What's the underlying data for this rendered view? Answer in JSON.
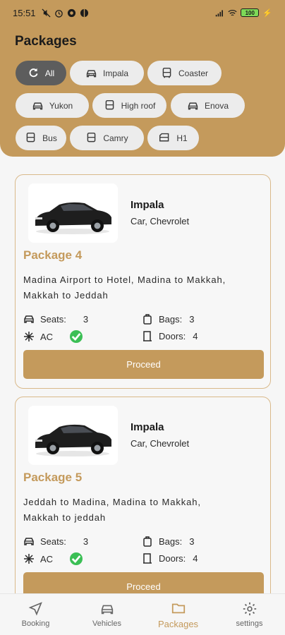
{
  "status": {
    "time": "15:51",
    "battery": "100"
  },
  "header": {
    "title": "Packages"
  },
  "filters": [
    {
      "label": "All",
      "icon": "refresh-icon",
      "active": true
    },
    {
      "label": "Impala",
      "icon": "car-icon"
    },
    {
      "label": "Coaster",
      "icon": "bus-icon"
    },
    {
      "label": "Yukon",
      "icon": "car-icon"
    },
    {
      "label": "High roof",
      "icon": "bus-icon"
    },
    {
      "label": "Enova",
      "icon": "car-icon"
    },
    {
      "label": "Bus",
      "icon": "bus-icon"
    },
    {
      "label": "Camry",
      "icon": "bus-icon"
    },
    {
      "label": "H1",
      "icon": "van-icon"
    }
  ],
  "packages": [
    {
      "model": "Impala",
      "brand": "Car, Chevrolet",
      "title": "Package 4",
      "route": "Madina Airport to Hotel, Madina to Makkah, Makkah to Jeddah",
      "seats_label": "Seats:",
      "seats": "3",
      "bags_label": "Bags:",
      "bags": "3",
      "ac_label": "AC",
      "doors_label": "Doors:",
      "doors": "4",
      "button": "Proceed"
    },
    {
      "model": "Impala",
      "brand": "Car, Chevrolet",
      "title": "Package 5",
      "route": "Jeddah to Madina, Madina to Makkah, Makkah to jeddah",
      "seats_label": "Seats:",
      "seats": "3",
      "bags_label": "Bags:",
      "bags": "3",
      "ac_label": "AC",
      "doors_label": "Doors:",
      "doors": "4",
      "button": "Proceed"
    }
  ],
  "nav": [
    {
      "label": "Booking",
      "icon": "navigation-icon"
    },
    {
      "label": "Vehicles",
      "icon": "car-icon"
    },
    {
      "label": "Packages",
      "icon": "package-icon",
      "active": true
    },
    {
      "label": "settings",
      "icon": "gear-icon"
    }
  ],
  "colors": {
    "accent": "#c49a5c",
    "chip_bg": "#ececec",
    "chip_active": "#5d5d5d",
    "check": "#3bbf55"
  }
}
